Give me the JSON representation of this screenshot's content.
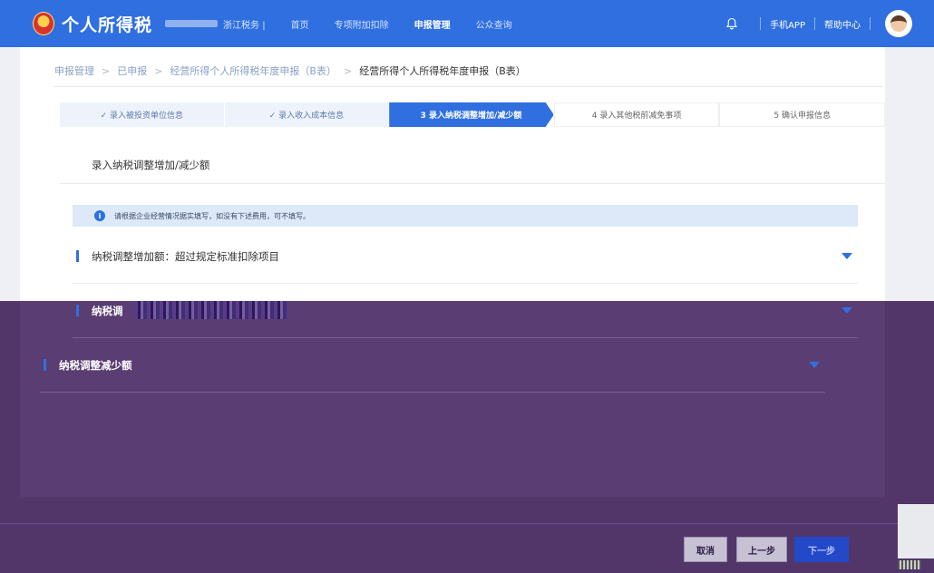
{
  "header": {
    "brand": "个人所得税",
    "region": "浙江税务 |",
    "nav": [
      "首页",
      "专项附加扣除",
      "申报管理",
      "公众查询"
    ],
    "active_nav": "申报管理",
    "app_link": "手机APP",
    "help_link": "帮助中心"
  },
  "breadcrumb": [
    "申报管理",
    "已申报",
    "经营所得个人所得税年度申报（B表）",
    "经营所得个人所得税年度申报（B表）"
  ],
  "steps": [
    {
      "label": "✓ 录入被投资单位信息",
      "state": "done"
    },
    {
      "label": "✓ 录入收入成本信息",
      "state": "done"
    },
    {
      "label": "3 录入纳税调整增加/减少额",
      "state": "active"
    },
    {
      "label": "4 录入其他税前减免事项",
      "state": "upcoming"
    },
    {
      "label": "5 确认申报信息",
      "state": "upcoming"
    }
  ],
  "section": {
    "title": "录入纳税调整增加/减少额",
    "info": "请根据企业经营情况据实填写，如没有下述费用，可不填写。"
  },
  "accordion": [
    {
      "label": "纳税调整增加额：超过规定标准扣除项目"
    },
    {
      "label": "纳税调"
    },
    {
      "label": "纳税调整减少额"
    }
  ],
  "footer": {
    "cancel": "取消",
    "prev": "上一步",
    "next": "下一步"
  },
  "colors": {
    "primary": "#2f6fe0",
    "overlay": "#46285f"
  }
}
